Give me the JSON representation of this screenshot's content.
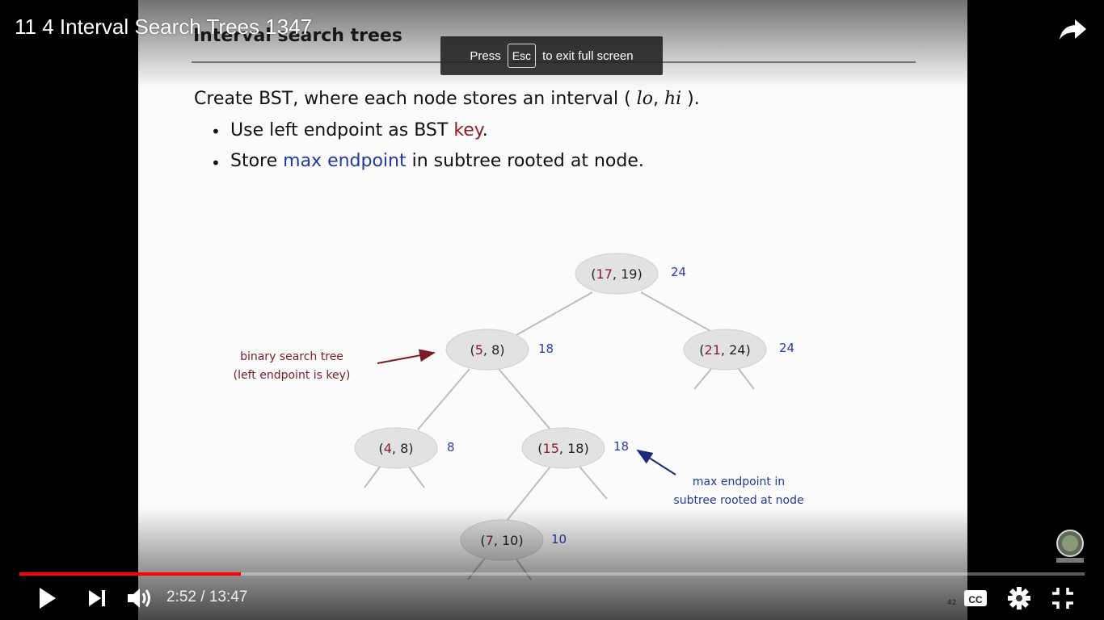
{
  "player": {
    "title": "11 4 Interval Search Trees 1347",
    "fullscreen_notice": {
      "press": "Press",
      "key": "Esc",
      "suffix": "to exit full screen"
    },
    "time": {
      "current": "2:52",
      "separator": "/",
      "duration": "13:47"
    },
    "progress_fraction": 0.208,
    "colors": {
      "progress_played": "#ff0000",
      "controls": "#ffffff"
    },
    "icons": [
      "share-icon",
      "play-icon",
      "next-icon",
      "volume-icon",
      "subtitles-icon",
      "settings-icon",
      "exit-fullscreen-icon"
    ]
  },
  "slide": {
    "heading": "Interval search trees",
    "line1": {
      "pre": "Create BST, where each node stores an interval ( ",
      "lo": "lo",
      "comma": ",  ",
      "hi": "hi",
      "post": " )."
    },
    "bullet1": {
      "pre": "Use left endpoint as BST ",
      "key": "key",
      "post": "."
    },
    "bullet2": {
      "pre": "Store ",
      "max": "max endpoint",
      "post": " in subtree rooted at node."
    },
    "bullet_symbol": "•",
    "slide_number": "42",
    "tree": {
      "nodes": [
        {
          "lo": "17",
          "hi": "19",
          "max": "24"
        },
        {
          "lo": "5",
          "hi": "8",
          "max": "18"
        },
        {
          "lo": "21",
          "hi": "24",
          "max": "24"
        },
        {
          "lo": "4",
          "hi": "8",
          "max": "8"
        },
        {
          "lo": "15",
          "hi": "18",
          "max": "18"
        },
        {
          "lo": "7",
          "hi": "10",
          "max": "10"
        }
      ],
      "annotation_bst": [
        "binary search tree",
        "(left endpoint is key)"
      ],
      "annotation_max": [
        "max endpoint in",
        "subtree rooted at node"
      ]
    }
  }
}
